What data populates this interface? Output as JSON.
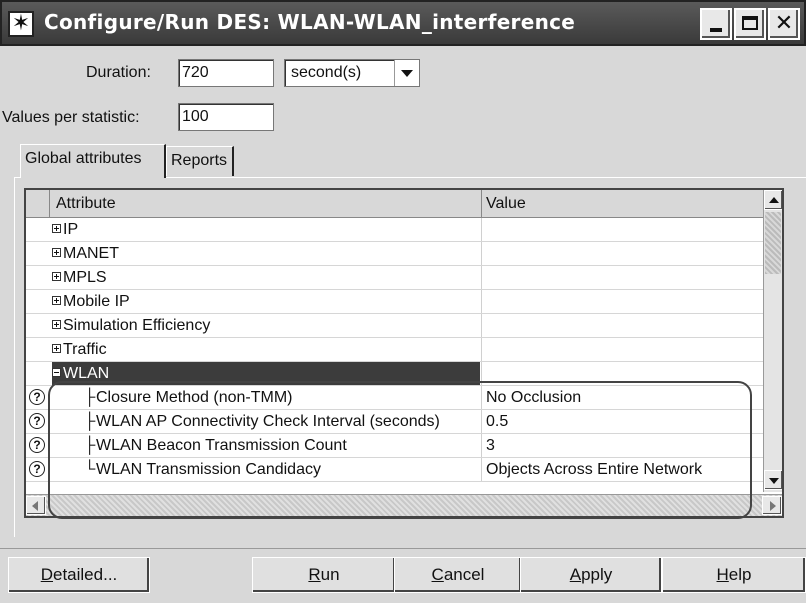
{
  "window": {
    "title": "Configure/Run DES: WLAN-WLAN_interference",
    "icon": "star-icon"
  },
  "duration": {
    "label": "Duration:",
    "value": "720",
    "unit": "second(s)"
  },
  "values_per_statistic": {
    "label": "Values per statistic:",
    "value": "100"
  },
  "tabs": [
    {
      "label": "Global attributes",
      "active": true
    },
    {
      "label": "Reports",
      "active": false
    }
  ],
  "table": {
    "columns": [
      "Attribute",
      "Value"
    ],
    "rows": [
      {
        "name": "IP",
        "value": "",
        "expander": "plus"
      },
      {
        "name": "MANET",
        "value": "",
        "expander": "plus"
      },
      {
        "name": "MPLS",
        "value": "",
        "expander": "plus"
      },
      {
        "name": "Mobile IP",
        "value": "",
        "expander": "plus"
      },
      {
        "name": "Simulation Efficiency",
        "value": "",
        "expander": "plus"
      },
      {
        "name": "Traffic",
        "value": "",
        "expander": "plus"
      },
      {
        "name": "WLAN",
        "value": "",
        "expander": "minus",
        "selected": true
      },
      {
        "name": "Closure Method (non-TMM)",
        "value": "No Occlusion",
        "child": true
      },
      {
        "name": "WLAN AP Connectivity Check Interval (seconds)",
        "value": "0.5",
        "child": true
      },
      {
        "name": "WLAN Beacon Transmission Count",
        "value": "3",
        "child": true
      },
      {
        "name": "WLAN Transmission Candidacy",
        "value": "Objects Across Entire Network",
        "child": true,
        "last": true
      }
    ]
  },
  "buttons": {
    "detailed": "Detailed...",
    "run": "Run",
    "cancel": "Cancel",
    "apply": "Apply",
    "help": "Help"
  },
  "colors": {
    "selection": "#3c3c3c",
    "titlebar": "#3a3a3a"
  }
}
